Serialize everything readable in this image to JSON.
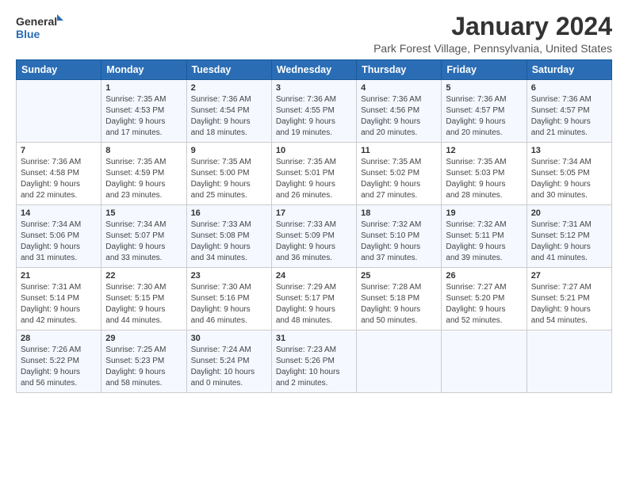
{
  "logo": {
    "line1": "General",
    "line2": "Blue"
  },
  "title": "January 2024",
  "location": "Park Forest Village, Pennsylvania, United States",
  "headers": [
    "Sunday",
    "Monday",
    "Tuesday",
    "Wednesday",
    "Thursday",
    "Friday",
    "Saturday"
  ],
  "weeks": [
    [
      {
        "day": "",
        "content": ""
      },
      {
        "day": "1",
        "content": "Sunrise: 7:35 AM\nSunset: 4:53 PM\nDaylight: 9 hours\nand 17 minutes."
      },
      {
        "day": "2",
        "content": "Sunrise: 7:36 AM\nSunset: 4:54 PM\nDaylight: 9 hours\nand 18 minutes."
      },
      {
        "day": "3",
        "content": "Sunrise: 7:36 AM\nSunset: 4:55 PM\nDaylight: 9 hours\nand 19 minutes."
      },
      {
        "day": "4",
        "content": "Sunrise: 7:36 AM\nSunset: 4:56 PM\nDaylight: 9 hours\nand 20 minutes."
      },
      {
        "day": "5",
        "content": "Sunrise: 7:36 AM\nSunset: 4:57 PM\nDaylight: 9 hours\nand 20 minutes."
      },
      {
        "day": "6",
        "content": "Sunrise: 7:36 AM\nSunset: 4:57 PM\nDaylight: 9 hours\nand 21 minutes."
      }
    ],
    [
      {
        "day": "7",
        "content": "Sunrise: 7:36 AM\nSunset: 4:58 PM\nDaylight: 9 hours\nand 22 minutes."
      },
      {
        "day": "8",
        "content": "Sunrise: 7:35 AM\nSunset: 4:59 PM\nDaylight: 9 hours\nand 23 minutes."
      },
      {
        "day": "9",
        "content": "Sunrise: 7:35 AM\nSunset: 5:00 PM\nDaylight: 9 hours\nand 25 minutes."
      },
      {
        "day": "10",
        "content": "Sunrise: 7:35 AM\nSunset: 5:01 PM\nDaylight: 9 hours\nand 26 minutes."
      },
      {
        "day": "11",
        "content": "Sunrise: 7:35 AM\nSunset: 5:02 PM\nDaylight: 9 hours\nand 27 minutes."
      },
      {
        "day": "12",
        "content": "Sunrise: 7:35 AM\nSunset: 5:03 PM\nDaylight: 9 hours\nand 28 minutes."
      },
      {
        "day": "13",
        "content": "Sunrise: 7:34 AM\nSunset: 5:05 PM\nDaylight: 9 hours\nand 30 minutes."
      }
    ],
    [
      {
        "day": "14",
        "content": "Sunrise: 7:34 AM\nSunset: 5:06 PM\nDaylight: 9 hours\nand 31 minutes."
      },
      {
        "day": "15",
        "content": "Sunrise: 7:34 AM\nSunset: 5:07 PM\nDaylight: 9 hours\nand 33 minutes."
      },
      {
        "day": "16",
        "content": "Sunrise: 7:33 AM\nSunset: 5:08 PM\nDaylight: 9 hours\nand 34 minutes."
      },
      {
        "day": "17",
        "content": "Sunrise: 7:33 AM\nSunset: 5:09 PM\nDaylight: 9 hours\nand 36 minutes."
      },
      {
        "day": "18",
        "content": "Sunrise: 7:32 AM\nSunset: 5:10 PM\nDaylight: 9 hours\nand 37 minutes."
      },
      {
        "day": "19",
        "content": "Sunrise: 7:32 AM\nSunset: 5:11 PM\nDaylight: 9 hours\nand 39 minutes."
      },
      {
        "day": "20",
        "content": "Sunrise: 7:31 AM\nSunset: 5:12 PM\nDaylight: 9 hours\nand 41 minutes."
      }
    ],
    [
      {
        "day": "21",
        "content": "Sunrise: 7:31 AM\nSunset: 5:14 PM\nDaylight: 9 hours\nand 42 minutes."
      },
      {
        "day": "22",
        "content": "Sunrise: 7:30 AM\nSunset: 5:15 PM\nDaylight: 9 hours\nand 44 minutes."
      },
      {
        "day": "23",
        "content": "Sunrise: 7:30 AM\nSunset: 5:16 PM\nDaylight: 9 hours\nand 46 minutes."
      },
      {
        "day": "24",
        "content": "Sunrise: 7:29 AM\nSunset: 5:17 PM\nDaylight: 9 hours\nand 48 minutes."
      },
      {
        "day": "25",
        "content": "Sunrise: 7:28 AM\nSunset: 5:18 PM\nDaylight: 9 hours\nand 50 minutes."
      },
      {
        "day": "26",
        "content": "Sunrise: 7:27 AM\nSunset: 5:20 PM\nDaylight: 9 hours\nand 52 minutes."
      },
      {
        "day": "27",
        "content": "Sunrise: 7:27 AM\nSunset: 5:21 PM\nDaylight: 9 hours\nand 54 minutes."
      }
    ],
    [
      {
        "day": "28",
        "content": "Sunrise: 7:26 AM\nSunset: 5:22 PM\nDaylight: 9 hours\nand 56 minutes."
      },
      {
        "day": "29",
        "content": "Sunrise: 7:25 AM\nSunset: 5:23 PM\nDaylight: 9 hours\nand 58 minutes."
      },
      {
        "day": "30",
        "content": "Sunrise: 7:24 AM\nSunset: 5:24 PM\nDaylight: 10 hours\nand 0 minutes."
      },
      {
        "day": "31",
        "content": "Sunrise: 7:23 AM\nSunset: 5:26 PM\nDaylight: 10 hours\nand 2 minutes."
      },
      {
        "day": "",
        "content": ""
      },
      {
        "day": "",
        "content": ""
      },
      {
        "day": "",
        "content": ""
      }
    ]
  ]
}
